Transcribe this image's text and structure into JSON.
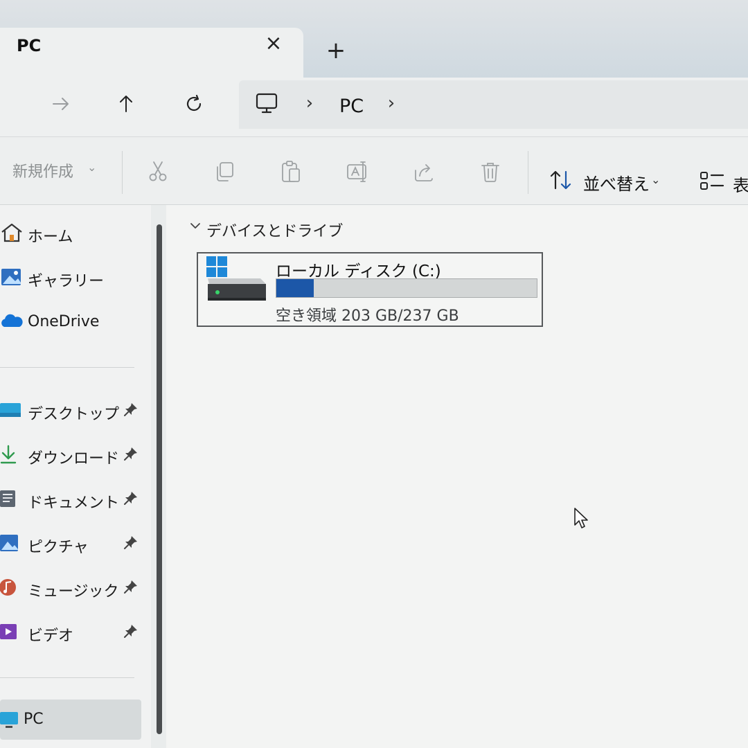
{
  "tab": {
    "title": "PC",
    "close_glyph": "×",
    "new_glyph": "+"
  },
  "nav": {
    "forward_icon": "arrow-right-icon",
    "up_icon": "arrow-up-icon",
    "refresh_icon": "refresh-icon",
    "address": {
      "location_icon": "monitor-icon",
      "segment": "PC",
      "separator": "›"
    }
  },
  "command_bar": {
    "new_label": "新規作成",
    "new_caret": "⌄",
    "sort_label": "並べ替え",
    "sort_caret": "⌄",
    "view_label": "表",
    "icons": [
      "scissors-icon",
      "copy-icon",
      "paste-icon",
      "rename-icon",
      "share-icon",
      "trash-icon"
    ]
  },
  "sidebar": {
    "items": [
      {
        "label": "ホーム",
        "icon": "home-icon"
      },
      {
        "label": "ギャラリー",
        "icon": "gallery-icon"
      },
      {
        "label": "OneDrive",
        "icon": "cloud-icon"
      }
    ],
    "pinned": [
      {
        "label": "デスクトップ",
        "icon": "desktop-folder-icon"
      },
      {
        "label": "ダウンロード",
        "icon": "download-icon"
      },
      {
        "label": "ドキュメント",
        "icon": "document-icon"
      },
      {
        "label": "ピクチャ",
        "icon": "pictures-icon"
      },
      {
        "label": "ミュージック",
        "icon": "music-icon"
      },
      {
        "label": "ビデオ",
        "icon": "video-icon"
      }
    ],
    "pc": {
      "label": "PC",
      "icon": "pc-icon"
    }
  },
  "main": {
    "group_title": "デバイスとドライブ",
    "drive": {
      "name": "ローカル ディスク (C:)",
      "space_text": "空き領域 203 GB/237 GB",
      "free_gb": 203,
      "total_gb": 237
    }
  },
  "colors": {
    "accent": "#1c57a8",
    "windows_logo": "#1e88d8"
  }
}
